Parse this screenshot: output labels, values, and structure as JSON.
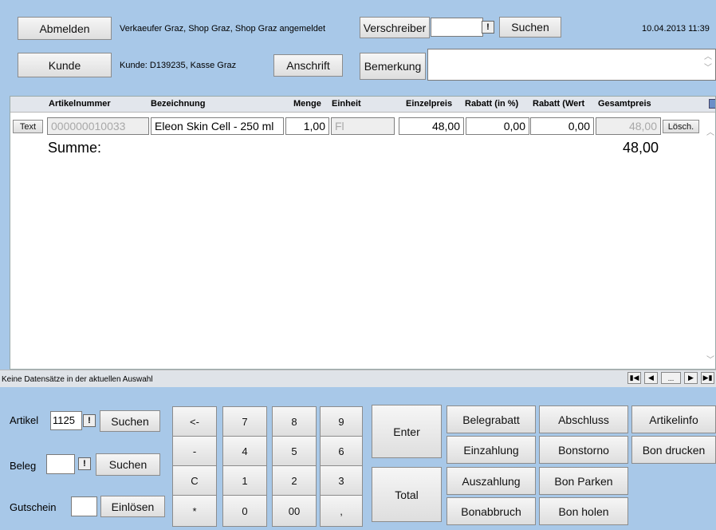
{
  "top": {
    "logout_label": "Abmelden",
    "login_info": "Verkaeufer Graz, Shop Graz, Shop Graz angemeldet",
    "prescriber_label": "Verschreiber",
    "prescriber_value": "",
    "search_label": "Suchen",
    "datetime": "10.04.2013 11:39",
    "customer_label": "Kunde",
    "customer_info": "Kunde: D139235, Kasse Graz",
    "address_label": "Anschrift",
    "remark_label": "Bemerkung",
    "remark_value": ""
  },
  "grid": {
    "columns": [
      "Artikelnummer",
      "Bezeichnung",
      "Menge",
      "Einheit",
      "Einzelpreis",
      "Rabatt (in %)",
      "Rabatt (Wert",
      "Gesamtpreis"
    ],
    "rows": [
      {
        "text_button": "Text",
        "article_number": "000000010033",
        "description": "Eleon Skin Cell - 250 ml",
        "quantity": "1,00",
        "unit": "Fl",
        "unit_price": "48,00",
        "discount_percent": "0,00",
        "discount_value": "0,00",
        "total_price": "48,00",
        "delete_label": "Lösch."
      }
    ],
    "sum_label": "Summe:",
    "sum_value": "48,00"
  },
  "status": {
    "text": "Keine Datensätze in der aktuellen Auswahl",
    "nav_dots": "..."
  },
  "bottom": {
    "article_label": "Artikel",
    "article_value": "1125",
    "voucher_label": "Beleg",
    "voucher_value": "",
    "gift_label": "Gutschein",
    "gift_value": "",
    "search_label": "Suchen",
    "redeem_label": "Einlösen",
    "keypad": [
      "<-",
      "7",
      "8",
      "9",
      "-",
      "4",
      "5",
      "6",
      "C",
      "1",
      "2",
      "3",
      "*",
      "0",
      "00",
      ","
    ],
    "enter_label": "Enter",
    "total_label": "Total",
    "actions": {
      "receipt_discount": "Belegrabatt",
      "deposit": "Einzahlung",
      "payout": "Auszahlung",
      "receipt_cancel": "Bonabbruch",
      "close": "Abschluss",
      "bon_storno": "Bonstorno",
      "bon_park": "Bon Parken",
      "bon_fetch": "Bon holen",
      "article_info": "Artikelinfo",
      "bon_print": "Bon drucken"
    }
  }
}
